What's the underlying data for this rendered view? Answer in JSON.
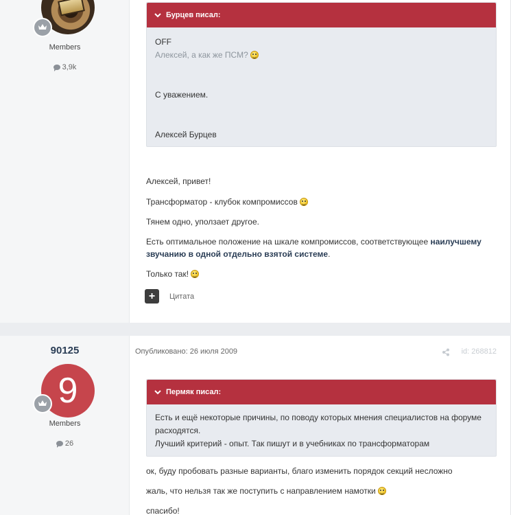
{
  "post1": {
    "author": {
      "group": "Members",
      "post_count": "3,9k"
    },
    "quote": {
      "header": "Бурцев писал:",
      "line1": "OFF",
      "line2": "Алексей, а как же ПСМ?",
      "line3": "С уважением.",
      "line4": "Алексей Бурцев"
    },
    "paragraphs": {
      "p1": "Алексей, привет!",
      "p2": "Трансформатор - клубок компромиссов",
      "p3": "Тянем одно, уползает другое.",
      "p4_start": "Есть оптимальное положение на шкале компромиссов, соответствующее ",
      "p4_bold1": "наилучшему",
      "p4_bold2": "звучанию в одной отдельно взятой системе",
      "p4_end": ".",
      "p5": "Только так!"
    },
    "actions": {
      "add_icon": "+",
      "quote_label": "Цитата"
    }
  },
  "post2": {
    "author": {
      "username": "90125",
      "avatar_letter": "9",
      "group": "Members",
      "post_count": "26"
    },
    "meta": {
      "published": "Опубликовано: 26 июля 2009",
      "id": "id: 268812"
    },
    "quote": {
      "header": "Пермяк писал:",
      "line1": "Есть и ещё некоторые причины, по поводу которых мнения специалистов на форуме",
      "line2": "расходятся.",
      "line3": "Лучший критерий - опыт. Так пишут и в учебниках по трансформаторам"
    },
    "paragraphs": {
      "p1": "ок, буду пробовать разные варианты, благо изменить порядок секций несложно",
      "p2": "жаль, что нельзя так же поступить с направлением намотки",
      "p3": "спасибо!"
    }
  },
  "icons": [
    "rank-badge-icon",
    "chat-bubble-icon",
    "chevron-down-icon",
    "smiley-icon",
    "share-icon",
    "plus-icon"
  ],
  "colors": {
    "quote_header": "#b5313f",
    "avatar2_bg": "#c6454c",
    "username": "#2b3e56"
  }
}
